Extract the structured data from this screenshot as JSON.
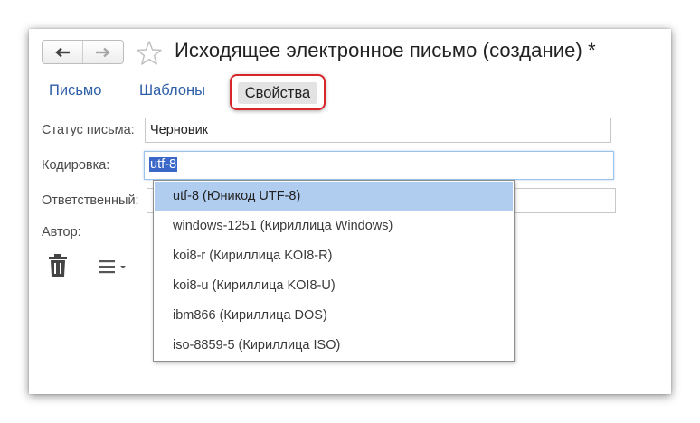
{
  "window": {
    "title": "Исходящее электронное письмо (создание) *"
  },
  "nav": {
    "back_icon": "arrow-left-icon",
    "forward_icon": "arrow-right-icon",
    "favorite_icon": "star-icon"
  },
  "tabs": [
    {
      "label": "Письмо"
    },
    {
      "label": "Шаблоны"
    },
    {
      "label": "Свойства",
      "active": true
    }
  ],
  "form": {
    "status_label": "Статус письма:",
    "status_value": "Черновик",
    "encoding_label": "Кодировка:",
    "encoding_value": "utf-8",
    "responsible_label": "Ответственный:",
    "responsible_value": "",
    "author_label": "Автор:"
  },
  "toolbar": {
    "delete_icon": "trash-icon",
    "menu_icon": "menu-dropdown-icon"
  },
  "encoding_dropdown": {
    "options": [
      "utf-8 (Юникод UTF-8)",
      "windows-1251 (Кириллица Windows)",
      "koi8-r (Кириллица KOI8-R)",
      "koi8-u (Кириллица KOI8-U)",
      "ibm866 (Кириллица DOS)",
      "iso-8859-5 (Кириллица ISO)"
    ],
    "selected_index": 0
  },
  "colors": {
    "tab_link": "#2e5fa8",
    "highlight_frame": "#d8262b",
    "selected_option": "#b0cdf0",
    "text_selection": "#3a67c8"
  }
}
